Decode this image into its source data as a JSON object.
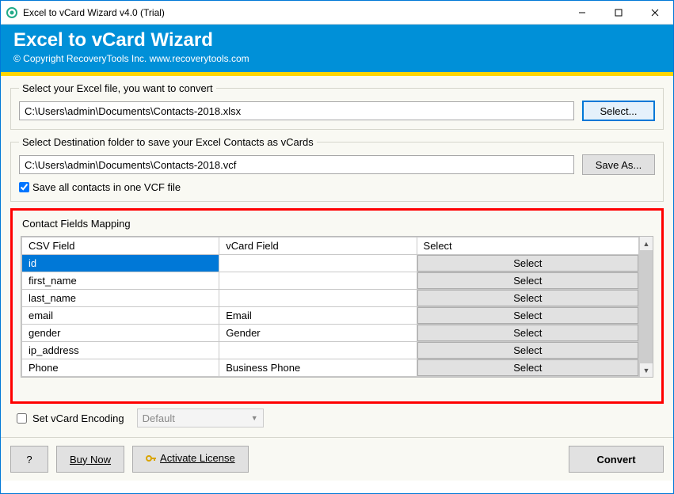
{
  "window": {
    "title": "Excel to vCard Wizard v4.0 (Trial)"
  },
  "header": {
    "title": "Excel to vCard Wizard",
    "copyright": "© Copyright RecoveryTools Inc. www.recoverytools.com"
  },
  "source": {
    "legend": "Select your Excel file, you want to convert",
    "path": "C:\\Users\\admin\\Documents\\Contacts-2018.xlsx",
    "select_label": "Select..."
  },
  "dest": {
    "legend": "Select Destination folder to save your Excel Contacts as vCards",
    "path": "C:\\Users\\admin\\Documents\\Contacts-2018.vcf",
    "saveas_label": "Save As...",
    "checkbox_label": "Save all contacts in one VCF file",
    "checkbox_checked": true
  },
  "mapping": {
    "legend": "Contact Fields Mapping",
    "columns": {
      "csv": "CSV Field",
      "vcard": "vCard Field",
      "select": "Select"
    },
    "select_btn": "Select",
    "rows": [
      {
        "csv": "id",
        "vcard": "",
        "selected": true
      },
      {
        "csv": "first_name",
        "vcard": ""
      },
      {
        "csv": "last_name",
        "vcard": ""
      },
      {
        "csv": "email",
        "vcard": "Email"
      },
      {
        "csv": "gender",
        "vcard": "Gender"
      },
      {
        "csv": "ip_address",
        "vcard": ""
      },
      {
        "csv": "Phone",
        "vcard": "Business Phone"
      }
    ]
  },
  "encoding": {
    "checkbox_label": "Set vCard Encoding",
    "value": "Default"
  },
  "footer": {
    "help": "?",
    "buy": "Buy Now",
    "activate": "Activate License",
    "convert": "Convert"
  }
}
